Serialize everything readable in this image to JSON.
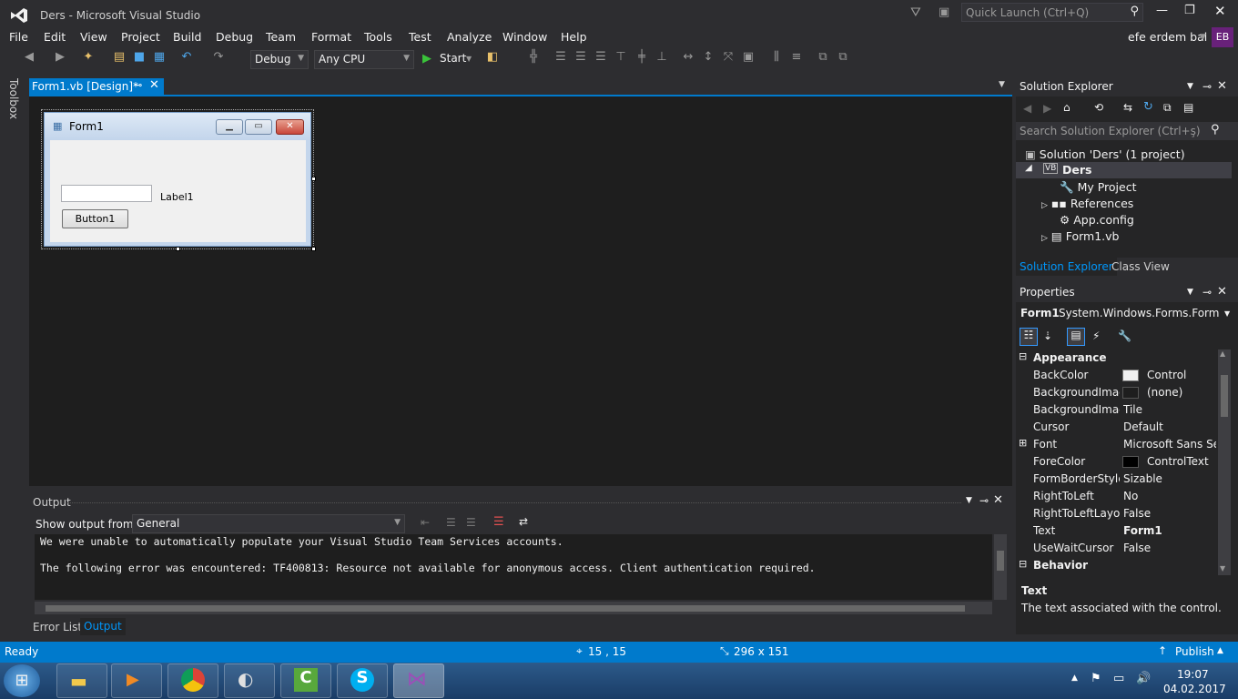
{
  "window": {
    "title": "Ders - Microsoft Visual Studio",
    "quick_launch_placeholder": "Quick Launch (Ctrl+Q)",
    "user": "efe erdem bal",
    "initials": "EB"
  },
  "menu": [
    "File",
    "Edit",
    "View",
    "Project",
    "Build",
    "Debug",
    "Team",
    "Format",
    "Tools",
    "Test",
    "Analyze",
    "Window",
    "Help"
  ],
  "toolbar": {
    "config": "Debug",
    "platform": "Any CPU",
    "start_label": "Start"
  },
  "toolbox_label": "Toolbox",
  "doc_tab": {
    "label": "Form1.vb [Design]*"
  },
  "form": {
    "caption": "Form1",
    "label": "Label1",
    "button": "Button1"
  },
  "output": {
    "title": "Output",
    "show_from_label": "Show output from:",
    "source": "General",
    "lines": [
      "We were unable to automatically populate your Visual Studio Team Services accounts.",
      "",
      "The following error was encountered: TF400813: Resource not available for anonymous access. Client authentication required."
    ]
  },
  "bottom_tabs": [
    "Error List",
    "Output"
  ],
  "solution_explorer": {
    "title": "Solution Explorer",
    "search_placeholder": "Search Solution Explorer (Ctrl+ş)",
    "solution": "Solution 'Ders' (1 project)",
    "project": "Ders",
    "items": [
      "My Project",
      "References",
      "App.config",
      "Form1.vb"
    ],
    "tabs": [
      "Solution Explorer",
      "Class View"
    ]
  },
  "properties": {
    "title": "Properties",
    "object": "Form1",
    "object_type": "System.Windows.Forms.Form",
    "category_appearance": "Appearance",
    "category_behavior": "Behavior",
    "rows": [
      {
        "name": "BackColor",
        "value": "Control"
      },
      {
        "name": "BackgroundImage",
        "value": "(none)"
      },
      {
        "name": "BackgroundImageLayout",
        "value": "Tile"
      },
      {
        "name": "Cursor",
        "value": "Default"
      },
      {
        "name": "Font",
        "value": "Microsoft Sans Serif"
      },
      {
        "name": "ForeColor",
        "value": "ControlText"
      },
      {
        "name": "FormBorderStyle",
        "value": "Sizable"
      },
      {
        "name": "RightToLeft",
        "value": "No"
      },
      {
        "name": "RightToLeftLayout",
        "value": "False"
      },
      {
        "name": "Text",
        "value": "Form1"
      },
      {
        "name": "UseWaitCursor",
        "value": "False"
      }
    ],
    "desc_title": "Text",
    "desc_text": "The text associated with the control."
  },
  "status": {
    "ready": "Ready",
    "position": "15 , 15",
    "size": "296 x 151",
    "publish": "Publish"
  },
  "clock": {
    "time": "19:07",
    "date": "04.02.2017"
  },
  "colors": {
    "accent": "#007acc",
    "bg": "#2d2d30",
    "vs_purple": "#68217a"
  }
}
